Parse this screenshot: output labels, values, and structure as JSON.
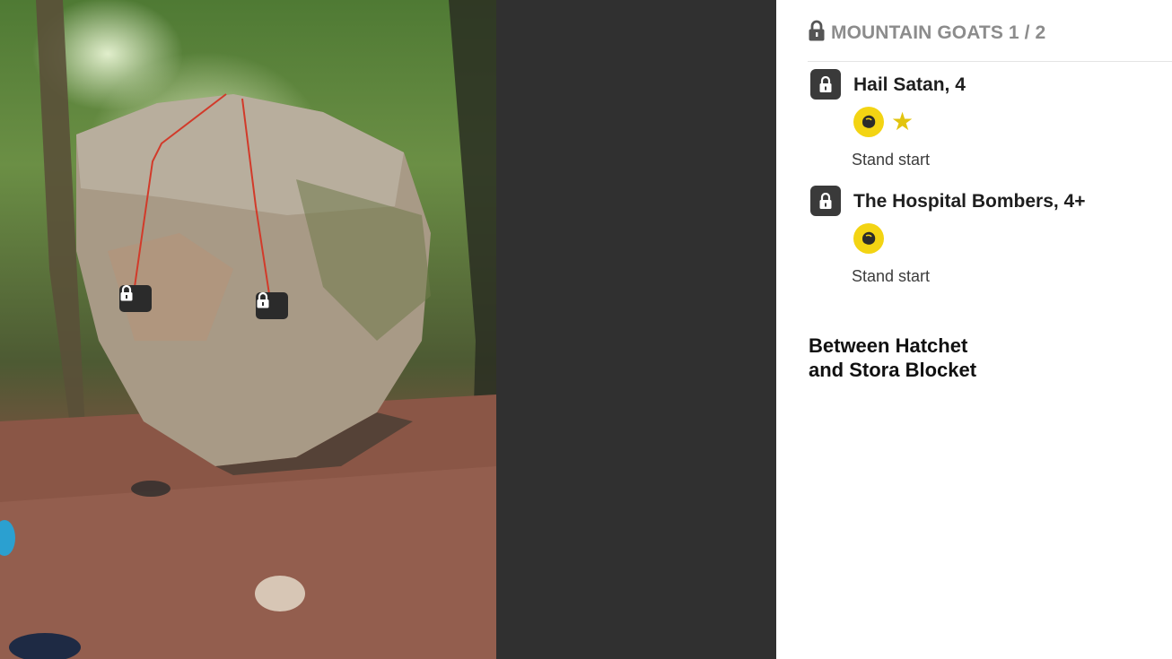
{
  "photo": {
    "description_alt": "",
    "route_line_color": "#d23a2a",
    "pins": [
      {
        "icon": "lock-icon"
      },
      {
        "icon": "lock-icon"
      }
    ]
  },
  "header": {
    "icon": "lock-icon",
    "title": "MOUNTAIN GOATS 1 / 2"
  },
  "problems": [
    {
      "icon": "lock-icon",
      "name": "Hail Satan, 4",
      "badges": [
        "hold-icon",
        "star-icon"
      ],
      "description": "Stand start"
    },
    {
      "icon": "lock-icon",
      "name": "The Hospital Bombers, 4+",
      "badges": [
        "hold-icon"
      ],
      "description": "Stand start"
    }
  ],
  "location_text": "Between Hatchet\nand Stora Blocket",
  "colors": {
    "accent_yellow": "#f3d413",
    "dark_panel": "#303030",
    "header_gray": "#8c8c8c"
  }
}
